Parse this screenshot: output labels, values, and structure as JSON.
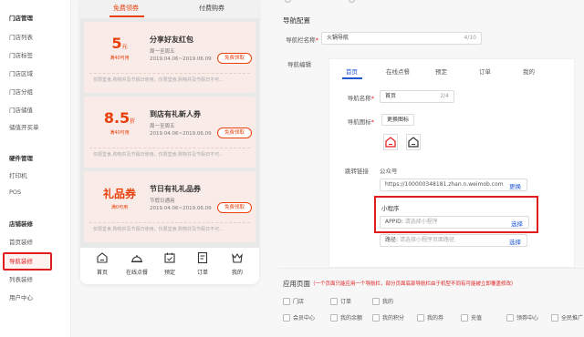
{
  "sidebar": {
    "groups": [
      {
        "title": "门店管理",
        "items": [
          "门店列表",
          "门店标签",
          "门店区域",
          "门店分组",
          "门店储值",
          "储值开买单"
        ]
      },
      {
        "title": "硬件管理",
        "items": [
          "打印机",
          "POS"
        ]
      },
      {
        "title": "店铺装修",
        "items": [
          "首页装修",
          "导航装修",
          "列表装修",
          "用户中心"
        ]
      }
    ],
    "active_item": "导航装修"
  },
  "phone": {
    "tabs": [
      "免费领券",
      "付费购券"
    ],
    "coupons": [
      {
        "amount": "5",
        "unit": "元",
        "condition": "满40可用",
        "title": "分享好友红包",
        "line1": "周一至周五",
        "line2": "2019.04.06~2019.06.09",
        "button": "免费领取",
        "desc": "仅限堂食,购物并及节假日使用。仅限堂食,购物并及节假日不可..."
      },
      {
        "amount": "8.5",
        "unit": "折",
        "condition": "满40可用",
        "title": "到店有礼新人券",
        "line1": "周一至周五",
        "line2": "2019.04.06~2019.06.09",
        "button": "免费领取",
        "desc": "仅限堂食,购物并及节假日使用。仅限堂食,购物并及节假日不可..."
      },
      {
        "amount": "礼品券",
        "unit": "",
        "condition": "满0可用",
        "title": "节日有礼礼品券",
        "line1": "节假日通用",
        "line2": "2019.04.06~2019.06.09",
        "button": "免费领取",
        "desc": "仅限堂食,购物并及节假日使用。仅限堂食,购物并及节假日不可..."
      }
    ],
    "navbar": [
      "首页",
      "在线点餐",
      "预定",
      "订单",
      "我的"
    ]
  },
  "config": {
    "section_title": "导航配置",
    "name_label": "导航栏名称",
    "name_value": "火锅导航",
    "name_counter": "4/10",
    "edit_label": "导航编辑",
    "edit_tabs": [
      "首页",
      "在线点餐",
      "预定",
      "订单",
      "我的"
    ],
    "nav_name_label": "导航名称",
    "nav_name_value": "首页",
    "nav_name_counter": "2/4",
    "nav_icon_label": "导航图标",
    "change_icon_button": "更换图标",
    "jump_label": "跳转链接",
    "official_label": "公众号",
    "official_url": "https://100000348181.zhan.n.weimob.com",
    "select_link": "更换",
    "mini_program_label": "小程序",
    "appid_label": "APPID:",
    "appid_placeholder": "请选择小程序",
    "appid_select": "选择",
    "path_label": "路径:",
    "path_placeholder": "请选择小程序页面路径",
    "path_select": "选择",
    "apply_title": "应用页面",
    "apply_note": "（一个页面只能应用一个导航栏，部分页面底部导航栏由于机型不同有可能被立即覆盖修改）",
    "pages_row1": [
      "门店",
      "订单",
      "我的"
    ],
    "pages_row2": [
      "会员中心",
      "我的余额",
      "我的积分",
      "我的券",
      "充值",
      "领券中心",
      "全民推广"
    ]
  },
  "colors": {
    "accent": "#e8400c",
    "highlight": "#e01c1c",
    "link": "#1f56d6"
  }
}
